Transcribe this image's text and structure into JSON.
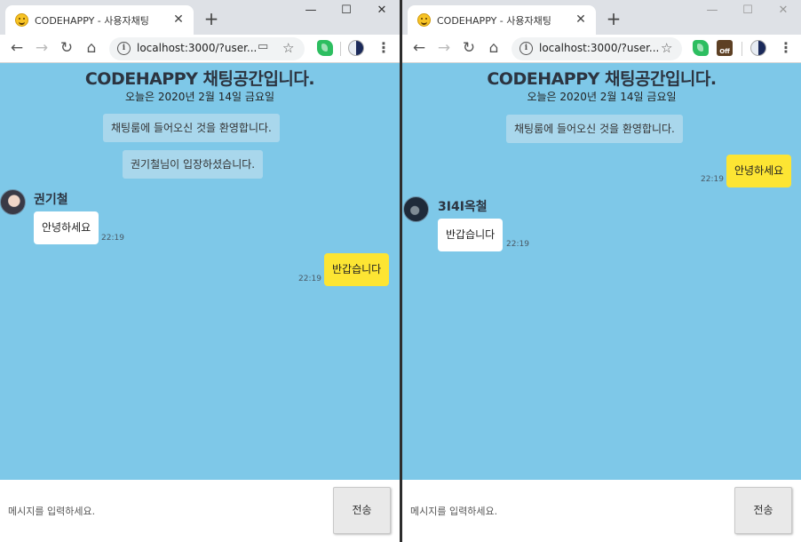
{
  "windows": [
    {
      "tab_title": "CODEHAPPY - 사용자채팅",
      "url": "localhost:3000/?user...",
      "extensions": [
        "cast-icon",
        "star-icon",
        "evernote-icon",
        "profile-icon",
        "menu-icon"
      ],
      "header_title": "CODEHAPPY 채팅공간입니다.",
      "header_date": "오늘은 2020년 2월 14일 금요일",
      "notices": [
        "채팅룸에 들어오신 것을 환영합니다.",
        "권기철님이 입장하셨습니다."
      ],
      "incoming_sender": "권기철",
      "incoming_text": "안녕하세요",
      "incoming_time": "22:19",
      "outgoing_text": "반갑습니다",
      "outgoing_time": "22:19",
      "input_placeholder": "메시지를 입력하세요.",
      "send_label": "전송"
    },
    {
      "tab_title": "CODEHAPPY - 사용자채팅",
      "url": "localhost:3000/?user...",
      "extensions": [
        "star-icon",
        "evernote-icon",
        "off-extension-icon",
        "profile-icon",
        "menu-icon"
      ],
      "off_badge": "Off",
      "header_title": "CODEHAPPY 채팅공간입니다.",
      "header_date": "오늘은 2020년 2월 14일 금요일",
      "notices": [
        "채팅룸에 들어오신 것을 환영합니다."
      ],
      "outgoing_text": "안녕하세요",
      "outgoing_time": "22:19",
      "incoming_sender": "3I4I옥철",
      "incoming_text": "반갑습니다",
      "incoming_time": "22:19",
      "input_placeholder": "메시지를 입력하세요.",
      "send_label": "전송"
    }
  ],
  "controls": {
    "tab_close": "✕",
    "new_tab": "+",
    "minimize": "—",
    "maximize": "☐",
    "close": "✕",
    "back": "←",
    "forward": "→",
    "reload": "↻",
    "home": "⌂",
    "info": "i",
    "cast": "▭",
    "star": "☆",
    "menu": "⋮"
  },
  "colors": {
    "chat_background": "#7ec8e8",
    "notice_background": "#a9d7ec",
    "outgoing_bubble": "#fde533",
    "incoming_bubble": "#ffffff"
  }
}
